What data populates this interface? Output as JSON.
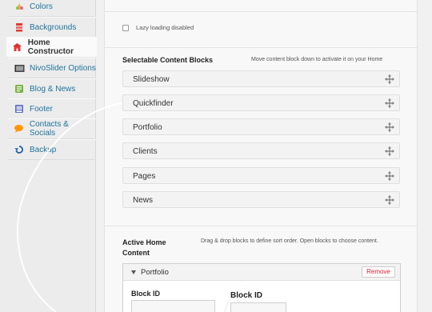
{
  "sidebar": {
    "items": [
      {
        "label": "Colors",
        "icon": "colors-icon"
      },
      {
        "label": "Backgrounds",
        "icon": "backgrounds-icon"
      },
      {
        "label": "Home Constructor",
        "icon": "home-constructor-icon",
        "active": true
      },
      {
        "label": "NivoSlider Options",
        "icon": "nivoslider-icon"
      },
      {
        "label": "Blog & News",
        "icon": "blog-icon"
      },
      {
        "label": "Footer",
        "icon": "footer-icon"
      },
      {
        "label": "Contacts & Socials",
        "icon": "contacts-icon"
      },
      {
        "label": "Backup",
        "icon": "backup-icon"
      }
    ]
  },
  "main": {
    "lazy_loading": {
      "label": "Lazy loading disabled",
      "checked": false
    },
    "selectable": {
      "title": "Selectable Content Blocks",
      "hint": "Move content block down to activate it on your Home",
      "blocks": [
        "Slideshow",
        "Quickfinder",
        "Portfolio",
        "Clients",
        "Pages",
        "News"
      ]
    },
    "active": {
      "title_line1": "Active Home",
      "title_line2": "Content",
      "hint": "Drag & drop blocks to define sort order. Open blocks to choose content.",
      "card": {
        "label": "Portfolio",
        "remove_label": "Remove",
        "field_label": "Block ID",
        "zoom_field_label": "Block ID"
      }
    }
  },
  "colors": {
    "link": "#21759b",
    "remove": "#dd2233",
    "accent_red": "#d9534f"
  }
}
